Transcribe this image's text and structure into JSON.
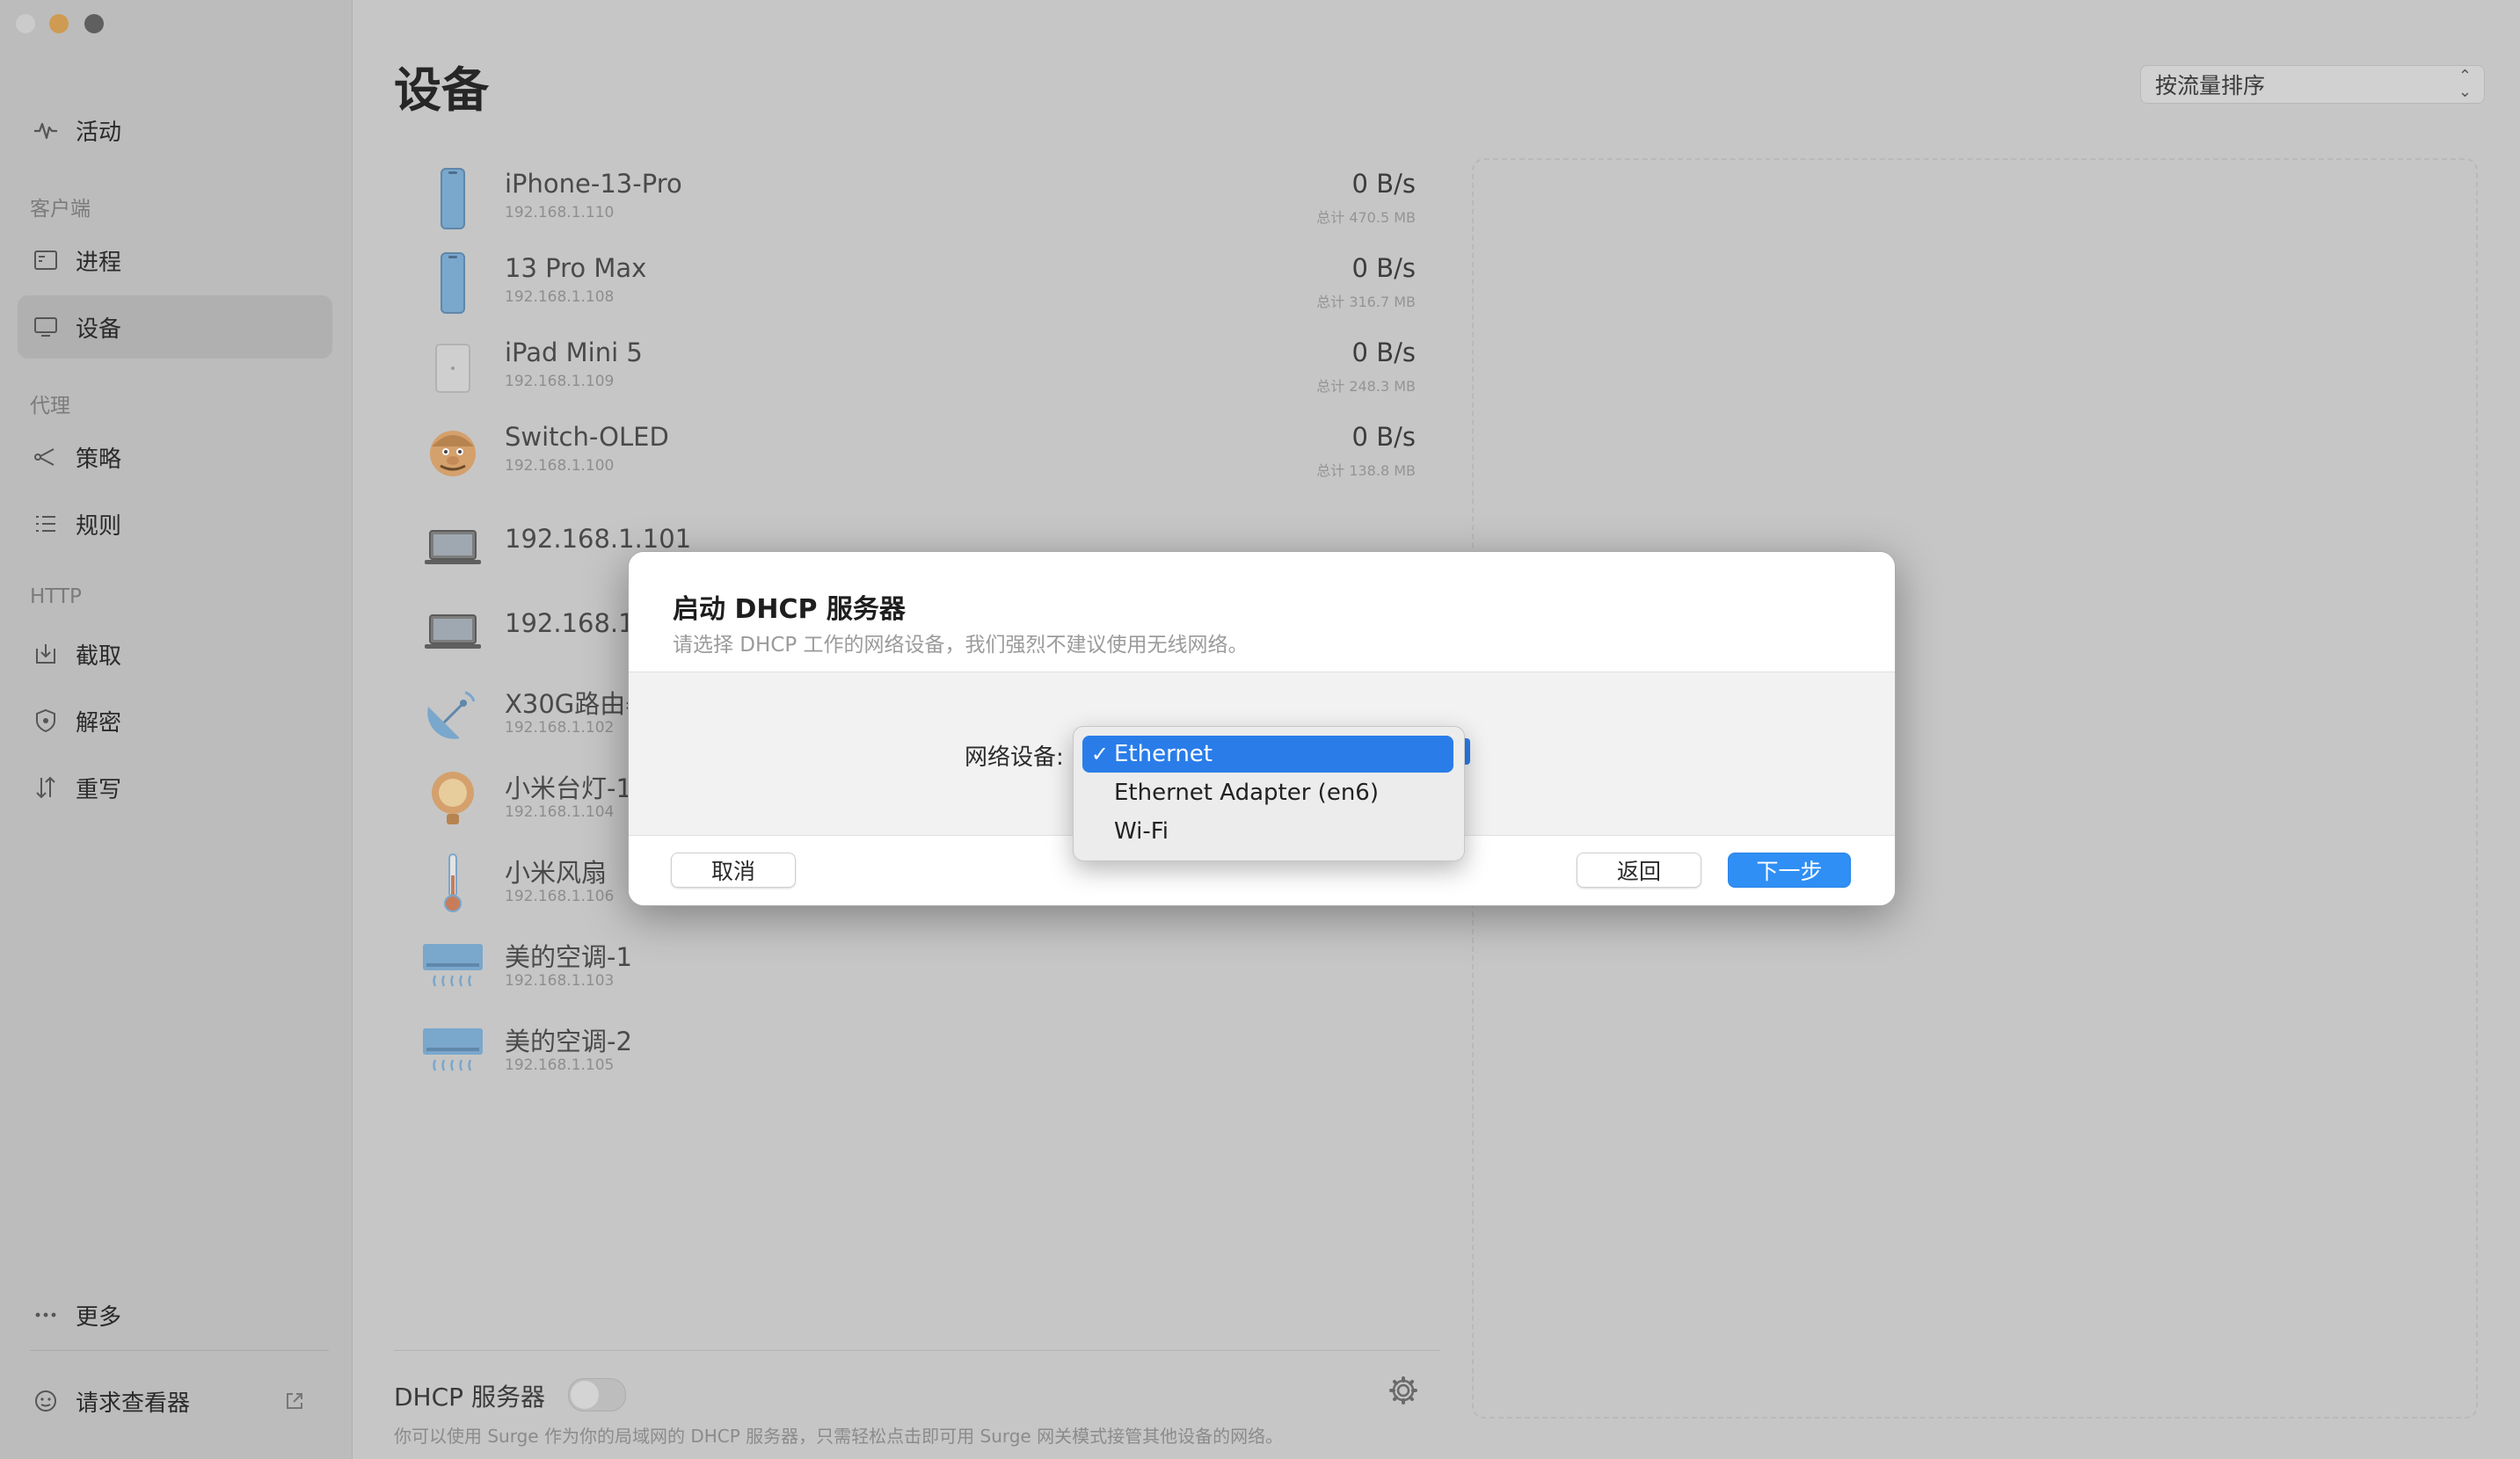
{
  "sidebar": {
    "activity": "活动",
    "section_client": "客户端",
    "process": "进程",
    "devices": "设备",
    "section_proxy": "代理",
    "policy": "策略",
    "rules": "规则",
    "section_http": "HTTP",
    "capture": "截取",
    "decrypt": "解密",
    "rewrite": "重写",
    "more": "更多",
    "request_viewer": "请求查看器"
  },
  "main": {
    "title": "设备",
    "sort_label": "按流量排序"
  },
  "devices": [
    {
      "name": "iPhone-13-Pro",
      "ip": "192.168.1.110",
      "speed": "0 B/s",
      "total": "总计 470.5 MB",
      "icon": "phone-icon"
    },
    {
      "name": "13 Pro Max",
      "ip": "192.168.1.108",
      "speed": "0 B/s",
      "total": "总计 316.7 MB",
      "icon": "phone-icon"
    },
    {
      "name": "iPad Mini 5",
      "ip": "192.168.1.109",
      "speed": "0 B/s",
      "total": "总计 248.3 MB",
      "icon": "tablet-icon"
    },
    {
      "name": "Switch-OLED",
      "ip": "192.168.1.100",
      "speed": "0 B/s",
      "total": "总计 138.8 MB",
      "icon": "mario-face-icon"
    },
    {
      "name": "192.168.1.101",
      "ip": "",
      "speed": "",
      "total": "",
      "icon": "laptop-icon"
    },
    {
      "name": "192.168.1.1",
      "ip": "",
      "speed": "",
      "total": "",
      "icon": "laptop-icon"
    },
    {
      "name": "X30G路由器",
      "ip": "192.168.1.102",
      "speed": "",
      "total": "",
      "icon": "satellite-dish-icon"
    },
    {
      "name": "小米台灯-1",
      "ip": "192.168.1.104",
      "speed": "",
      "total": "",
      "icon": "light-bulb-icon"
    },
    {
      "name": "小米风扇",
      "ip": "192.168.1.106",
      "speed": "",
      "total": "",
      "icon": "thermometer-icon"
    },
    {
      "name": "美的空调-1",
      "ip": "192.168.1.103",
      "speed": "",
      "total": "",
      "icon": "air-conditioner-icon"
    },
    {
      "name": "美的空调-2",
      "ip": "192.168.1.105",
      "speed": "",
      "total": "",
      "icon": "air-conditioner-icon"
    }
  ],
  "dhcp": {
    "title": "DHCP 服务器",
    "enabled": false,
    "description": "你可以使用 Surge 作为你的局域网的 DHCP 服务器，只需轻松点击即可用 Surge 网关模式接管其他设备的网络。"
  },
  "dialog": {
    "title": "启动 DHCP 服务器",
    "subtitle": "请选择 DHCP 工作的网络设备，我们强烈不建议使用无线网络。",
    "field_label": "网络设备:",
    "options": [
      "Ethernet",
      "Ethernet Adapter (en6)",
      "Wi-Fi"
    ],
    "selected": "Ethernet",
    "check_mark": "✓",
    "cancel": "取消",
    "back": "返回",
    "next": "下一步"
  },
  "colors": {
    "accent": "#2f8ff5",
    "menu_highlight": "#2a7de9",
    "traffic_min": "#cf9b52"
  }
}
